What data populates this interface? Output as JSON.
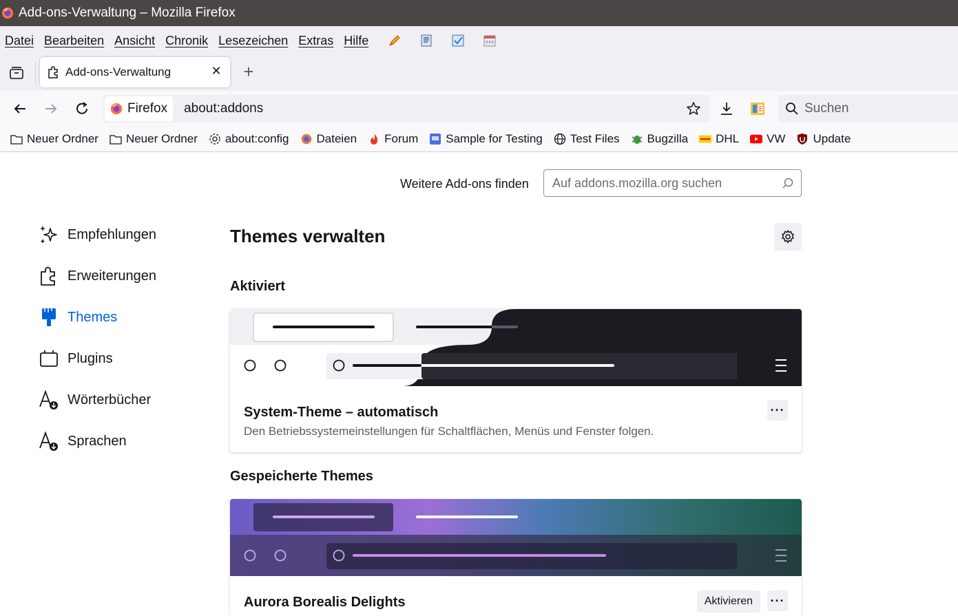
{
  "window": {
    "title": "Add-ons-Verwaltung – Mozilla Firefox"
  },
  "menubar": {
    "items": [
      "Datei",
      "Bearbeiten",
      "Ansicht",
      "Chronik",
      "Lesezeichen",
      "Extras",
      "Hilfe"
    ]
  },
  "tab": {
    "label": "Add-ons-Verwaltung"
  },
  "urlbar": {
    "identity_label": "Firefox",
    "url": "about:addons"
  },
  "searchbar": {
    "placeholder": "Suchen"
  },
  "bookmarks": [
    {
      "label": "Neuer Ordner",
      "icon": "folder-icon"
    },
    {
      "label": "Neuer Ordner",
      "icon": "folder-icon"
    },
    {
      "label": "about:config",
      "icon": "gear-icon"
    },
    {
      "label": "Dateien",
      "icon": "firefox-icon"
    },
    {
      "label": "Forum",
      "icon": "flame-icon"
    },
    {
      "label": "Sample for Testing",
      "icon": "page-icon"
    },
    {
      "label": "Test Files",
      "icon": "globe-icon"
    },
    {
      "label": "Bugzilla",
      "icon": "bug-icon"
    },
    {
      "label": "DHL",
      "icon": "dhl-icon"
    },
    {
      "label": "VW",
      "icon": "youtube-icon"
    },
    {
      "label": "Update",
      "icon": "shield-icon"
    }
  ],
  "content": {
    "find_label": "Weitere Add-ons finden",
    "find_placeholder": "Auf addons.mozilla.org suchen",
    "categories": [
      {
        "label": "Empfehlungen",
        "icon": "sparkle-icon"
      },
      {
        "label": "Erweiterungen",
        "icon": "puzzle-icon"
      },
      {
        "label": "Themes",
        "icon": "brush-icon",
        "active": true
      },
      {
        "label": "Plugins",
        "icon": "plugin-icon"
      },
      {
        "label": "Wörterbücher",
        "icon": "dictionary-icon"
      },
      {
        "label": "Sprachen",
        "icon": "language-icon"
      }
    ],
    "heading": "Themes verwalten",
    "section_enabled": "Aktiviert",
    "section_saved": "Gespeicherte Themes",
    "themes": [
      {
        "name": "System-Theme – automatisch",
        "description": "Den Betriebssystemeinstellungen für Schaltflächen, Menüs und Fenster folgen."
      },
      {
        "name": "Aurora Borealis Delights",
        "action": "Aktivieren"
      }
    ],
    "more_label": "···",
    "accent_color": "#0061e0"
  }
}
